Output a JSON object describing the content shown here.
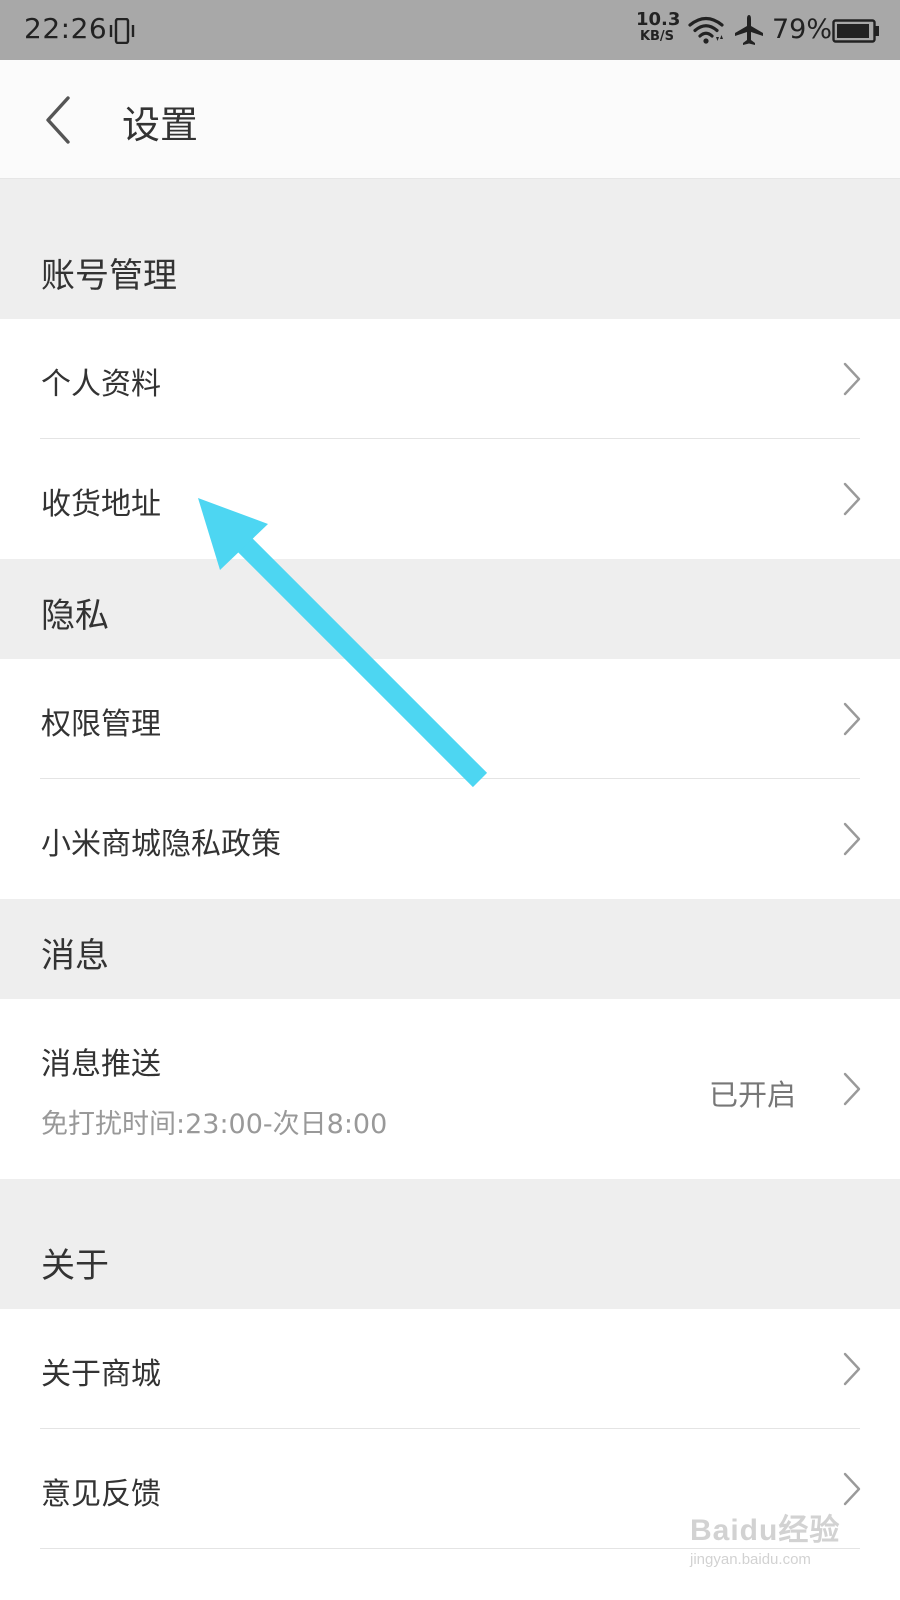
{
  "status_bar": {
    "time": "22:26",
    "net_speed_value": "10.3",
    "net_speed_unit": "KB/S",
    "battery_percent": "79%",
    "icons": [
      "vibrate-icon",
      "wifi-icon",
      "airplane-mode-icon",
      "battery-icon"
    ]
  },
  "header": {
    "title": "设置",
    "back_icon": "back-chevron-icon"
  },
  "sections": {
    "account": {
      "title": "账号管理",
      "items": [
        {
          "label": "个人资料"
        },
        {
          "label": "收货地址"
        }
      ]
    },
    "privacy": {
      "title": "隐私",
      "items": [
        {
          "label": "权限管理"
        },
        {
          "label": "小米商城隐私政策"
        }
      ]
    },
    "messages": {
      "title": "消息",
      "items": [
        {
          "label": "消息推送",
          "subtitle": "免打扰时间:23:00-次日8:00",
          "value": "已开启"
        }
      ]
    },
    "about": {
      "title": "关于",
      "items": [
        {
          "label": "关于商城"
        },
        {
          "label": "意见反馈"
        }
      ]
    }
  },
  "annotation": {
    "arrow_color": "#4dd6f2"
  },
  "watermark": {
    "brand": "Baidu经验",
    "url": "jingyan.baidu.com"
  },
  "colors": {
    "status_bar_bg": "#a8a8a8",
    "section_bg": "#eeeeee",
    "divider": "#e4e4e4",
    "text_primary": "#333333",
    "text_secondary": "#999999"
  }
}
